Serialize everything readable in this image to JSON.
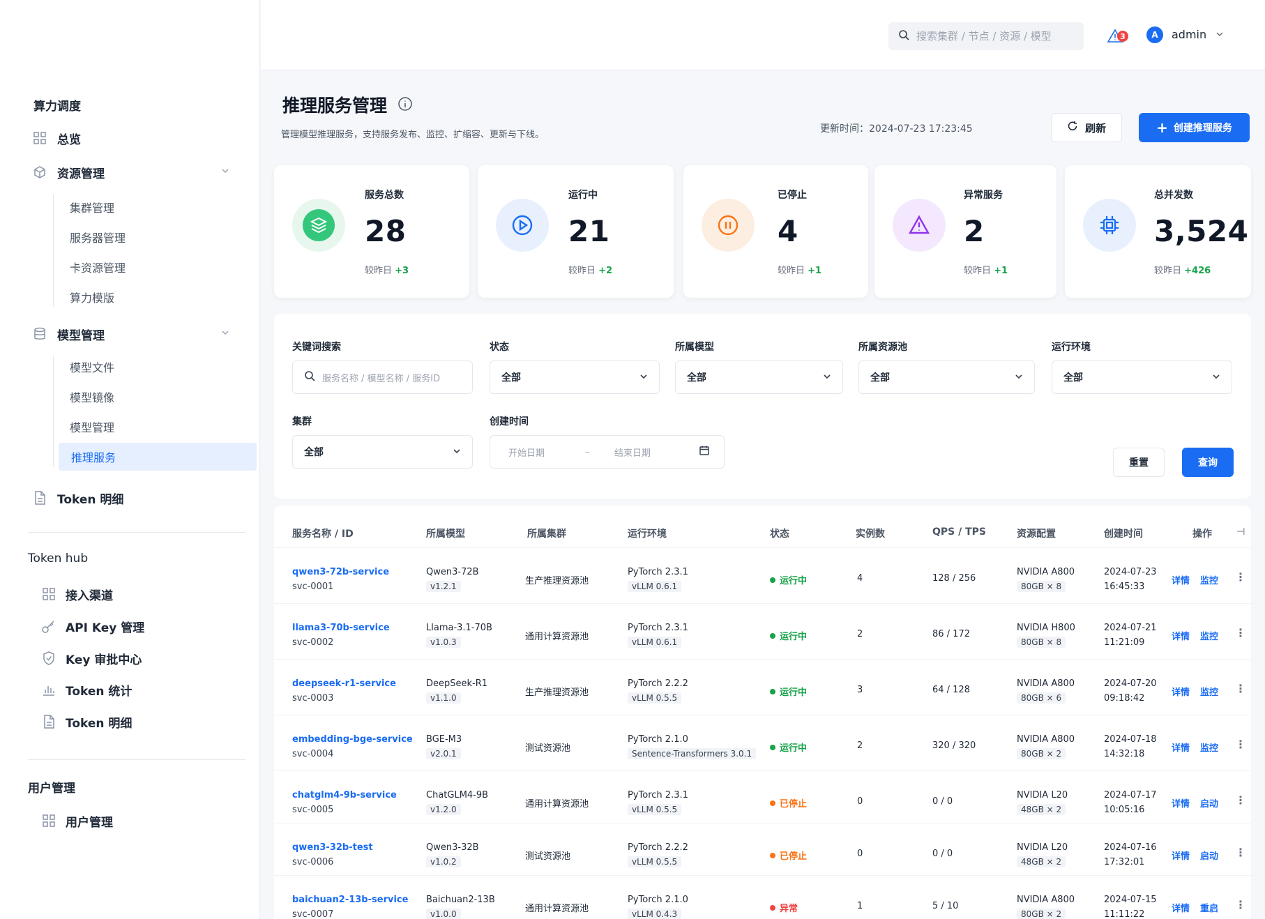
{
  "sidebar": {
    "section1": "算力调度",
    "overview": "总览",
    "resource_mgmt": "资源管理",
    "resource_subs": [
      "集群管理",
      "服务器管理",
      "卡资源管理",
      "算力模版"
    ],
    "model_mgmt": "模型管理",
    "model_subs": [
      "模型文件",
      "模型镜像",
      "模型管理",
      "推理服务"
    ],
    "token_detail": "Token 明细",
    "section2": "Token hub",
    "hub_items": [
      "接入渠道",
      "API Key 管理",
      "Key 审批中心",
      "Token 统计",
      "Token 明细"
    ],
    "section3": "用户管理",
    "user_item": "用户管理"
  },
  "header": {
    "search_placeholder": "搜索集群 / 节点 / 资源 / 模型",
    "notification_count": "3",
    "avatar_letter": "A",
    "username": "admin"
  },
  "page": {
    "title": "推理服务管理",
    "description": "管理模型推理服务，支持服务发布、监控、扩缩容、更新与下线。",
    "update_time": "更新时间：2024-07-23 17:23:45",
    "refresh_label": "刷新",
    "create_label": "创建推理服务"
  },
  "stats": [
    {
      "label": "服务总数",
      "value": "28",
      "delta_prefix": "较昨日",
      "delta": "+3",
      "color": "#16a34a"
    },
    {
      "label": "运行中",
      "value": "21",
      "delta_prefix": "较昨日",
      "delta": "+2",
      "color": "#1a6cf2"
    },
    {
      "label": "已停止",
      "value": "4",
      "delta_prefix": "较昨日",
      "delta": "+1",
      "color": "#f97316"
    },
    {
      "label": "异常服务",
      "value": "2",
      "delta_prefix": "较昨日",
      "delta": "+1",
      "color": "#9333ea"
    },
    {
      "label": "总并发数",
      "value": "3,524",
      "delta_prefix": "较昨日",
      "delta": "+426",
      "color": "#1a6cf2"
    }
  ],
  "filters": {
    "keyword_label": "关键词搜索",
    "keyword_placeholder": "服务名称 / 模型名称 / 服务ID",
    "status_label": "状态",
    "status_value": "全部",
    "model_label": "所属模型",
    "model_value": "全部",
    "pool_label": "所属资源池",
    "pool_value": "全部",
    "env_label": "运行环境",
    "env_value": "全部",
    "cluster_label": "集群",
    "cluster_value": "全部",
    "created_label": "创建时间",
    "start_placeholder": "开始日期",
    "date_sep": "–",
    "end_placeholder": "结束日期",
    "reset_label": "重置",
    "query_label": "查询"
  },
  "table": {
    "headers": [
      "服务名称 / ID",
      "所属模型",
      "所属集群",
      "运行环境",
      "状态",
      "实例数",
      "QPS / TPS",
      "资源配置",
      "创建时间",
      "操作"
    ],
    "rows": [
      {
        "name": "qwen3-72b-service",
        "id": "svc-0001",
        "model": "Qwen3-72B",
        "model_ver": "v1.2.1",
        "cluster": "生产推理资源池",
        "env": "PyTorch 2.3.1",
        "env2": "vLLM 0.6.1",
        "status": "运行中",
        "status_color": "#16a34a",
        "instances": "4",
        "qps": "128 / 256",
        "gpu": "NVIDIA A800",
        "gpu_mem": "80GB × 8",
        "date": "2024-07-23",
        "time": "16:45:33",
        "op1": "详情",
        "op2": "监控"
      },
      {
        "name": "llama3-70b-service",
        "id": "svc-0002",
        "model": "Llama-3.1-70B",
        "model_ver": "v1.0.3",
        "cluster": "通用计算资源池",
        "env": "PyTorch 2.3.1",
        "env2": "vLLM 0.6.1",
        "status": "运行中",
        "status_color": "#16a34a",
        "instances": "2",
        "qps": "86 / 172",
        "gpu": "NVIDIA H800",
        "gpu_mem": "80GB × 8",
        "date": "2024-07-21",
        "time": "11:21:09",
        "op1": "详情",
        "op2": "监控"
      },
      {
        "name": "deepseek-r1-service",
        "id": "svc-0003",
        "model": "DeepSeek-R1",
        "model_ver": "v1.1.0",
        "cluster": "生产推理资源池",
        "env": "PyTorch 2.2.2",
        "env2": "vLLM 0.5.5",
        "status": "运行中",
        "status_color": "#16a34a",
        "instances": "3",
        "qps": "64 / 128",
        "gpu": "NVIDIA A800",
        "gpu_mem": "80GB × 6",
        "date": "2024-07-20",
        "time": "09:18:42",
        "op1": "详情",
        "op2": "监控"
      },
      {
        "name": "embedding-bge-service",
        "id": "svc-0004",
        "model": "BGE-M3",
        "model_ver": "v2.0.1",
        "cluster": "测试资源池",
        "env": "PyTorch 2.1.0",
        "env2": "Sentence-Transformers 3.0.1",
        "status": "运行中",
        "status_color": "#16a34a",
        "instances": "2",
        "qps": "320 / 320",
        "gpu": "NVIDIA A800",
        "gpu_mem": "80GB × 2",
        "date": "2024-07-18",
        "time": "14:32:18",
        "op1": "详情",
        "op2": "监控"
      },
      {
        "name": "chatglm4-9b-service",
        "id": "svc-0005",
        "model": "ChatGLM4-9B",
        "model_ver": "v1.2.0",
        "cluster": "通用计算资源池",
        "env": "PyTorch 2.3.1",
        "env2": "vLLM 0.5.5",
        "status": "已停止",
        "status_color": "#f97316",
        "instances": "0",
        "qps": "0 / 0",
        "gpu": "NVIDIA L20",
        "gpu_mem": "48GB × 2",
        "date": "2024-07-17",
        "time": "10:05:16",
        "op1": "详情",
        "op2": "启动"
      },
      {
        "name": "qwen3-32b-test",
        "id": "svc-0006",
        "model": "Qwen3-32B",
        "model_ver": "v1.0.2",
        "cluster": "测试资源池",
        "env": "PyTorch 2.2.2",
        "env2": "vLLM 0.5.5",
        "status": "已停止",
        "status_color": "#f97316",
        "instances": "0",
        "qps": "0 / 0",
        "gpu": "NVIDIA L20",
        "gpu_mem": "48GB × 2",
        "date": "2024-07-16",
        "time": "17:32:01",
        "op1": "详情",
        "op2": "启动"
      },
      {
        "name": "baichuan2-13b-service",
        "id": "svc-0007",
        "model": "Baichuan2-13B",
        "model_ver": "v1.0.0",
        "cluster": "通用计算资源池",
        "env": "PyTorch 2.1.0",
        "env2": "vLLM 0.4.3",
        "status": "异常",
        "status_color": "#ef4444",
        "instances": "1",
        "qps": "5 / 10",
        "gpu": "NVIDIA A800",
        "gpu_mem": "80GB × 2",
        "date": "2024-07-15",
        "time": "11:11:22",
        "op1": "详情",
        "op2": "重启"
      }
    ]
  }
}
